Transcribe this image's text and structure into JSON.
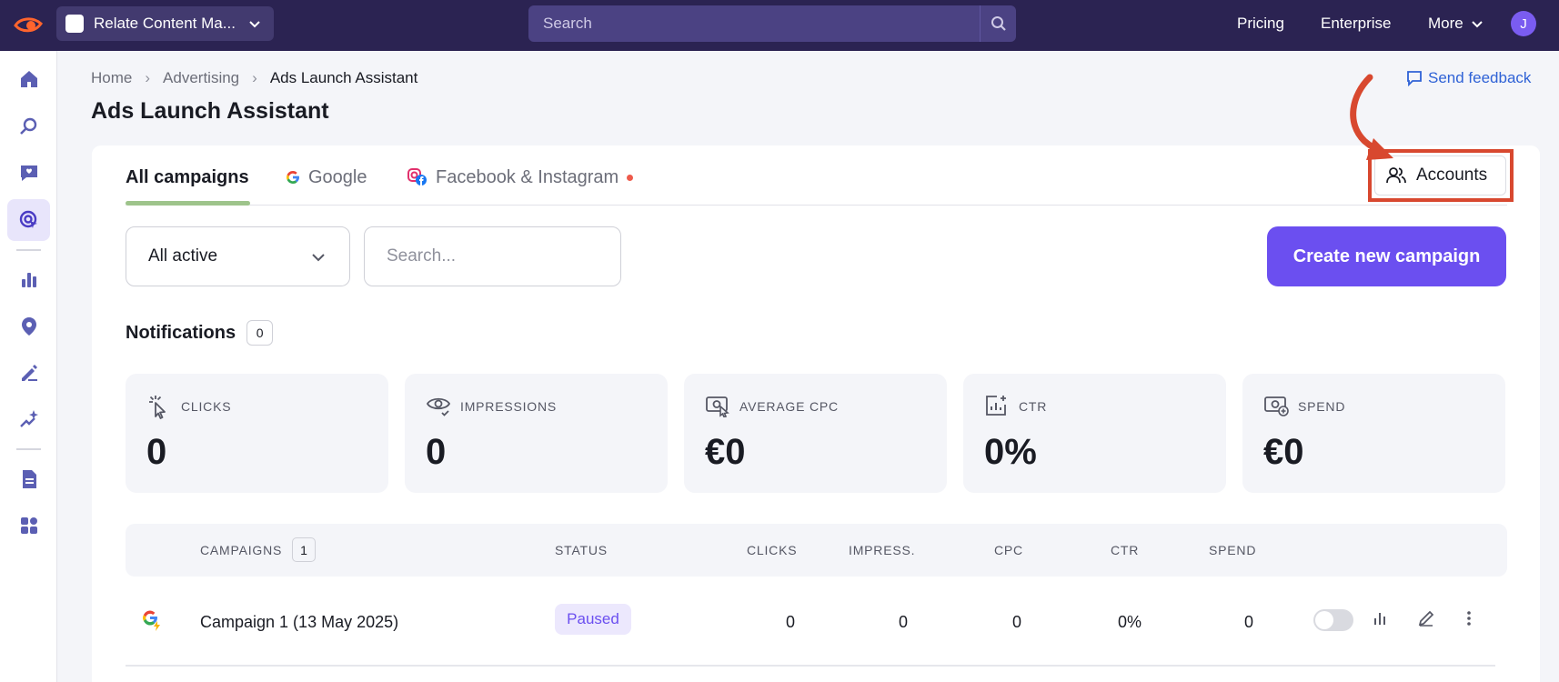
{
  "topbar": {
    "project_name": "Relate Content Ma...",
    "search_placeholder": "Search",
    "nav": [
      "Pricing",
      "Enterprise",
      "More"
    ],
    "avatar_letter": "J"
  },
  "breadcrumb": [
    "Home",
    "Advertising",
    "Ads Launch Assistant"
  ],
  "page_title": "Ads Launch Assistant",
  "feedback_label": "Send feedback",
  "tabs": [
    "All campaigns",
    "Google",
    "Facebook & Instagram"
  ],
  "accounts_label": "Accounts",
  "filter": {
    "selected": "All active",
    "search_placeholder": "Search..."
  },
  "create_label": "Create new campaign",
  "notifications": {
    "label": "Notifications",
    "count": "0"
  },
  "metrics": [
    {
      "label": "CLICKS",
      "value": "0",
      "icon": "cursor-click-icon"
    },
    {
      "label": "IMPRESSIONS",
      "value": "0",
      "icon": "eye-icon"
    },
    {
      "label": "AVERAGE CPC",
      "value": "€0",
      "icon": "money-cursor-icon"
    },
    {
      "label": "CTR",
      "value": "0%",
      "icon": "chart-plus-icon"
    },
    {
      "label": "SPEND",
      "value": "€0",
      "icon": "money-plus-icon"
    }
  ],
  "table": {
    "headers": [
      "CAMPAIGNS",
      "STATUS",
      "CLICKS",
      "IMPRESS.",
      "CPC",
      "CTR",
      "SPEND"
    ],
    "campaign_count": "1",
    "rows": [
      {
        "name": "Campaign 1 (13 May 2025)",
        "status": "Paused",
        "clicks": "0",
        "impress": "0",
        "cpc": "0",
        "ctr": "0%",
        "spend": "0",
        "enabled": false
      }
    ]
  },
  "colors": {
    "topbar": "#2b2352",
    "accent": "#6b4ff0",
    "highlight": "#d8482f"
  }
}
